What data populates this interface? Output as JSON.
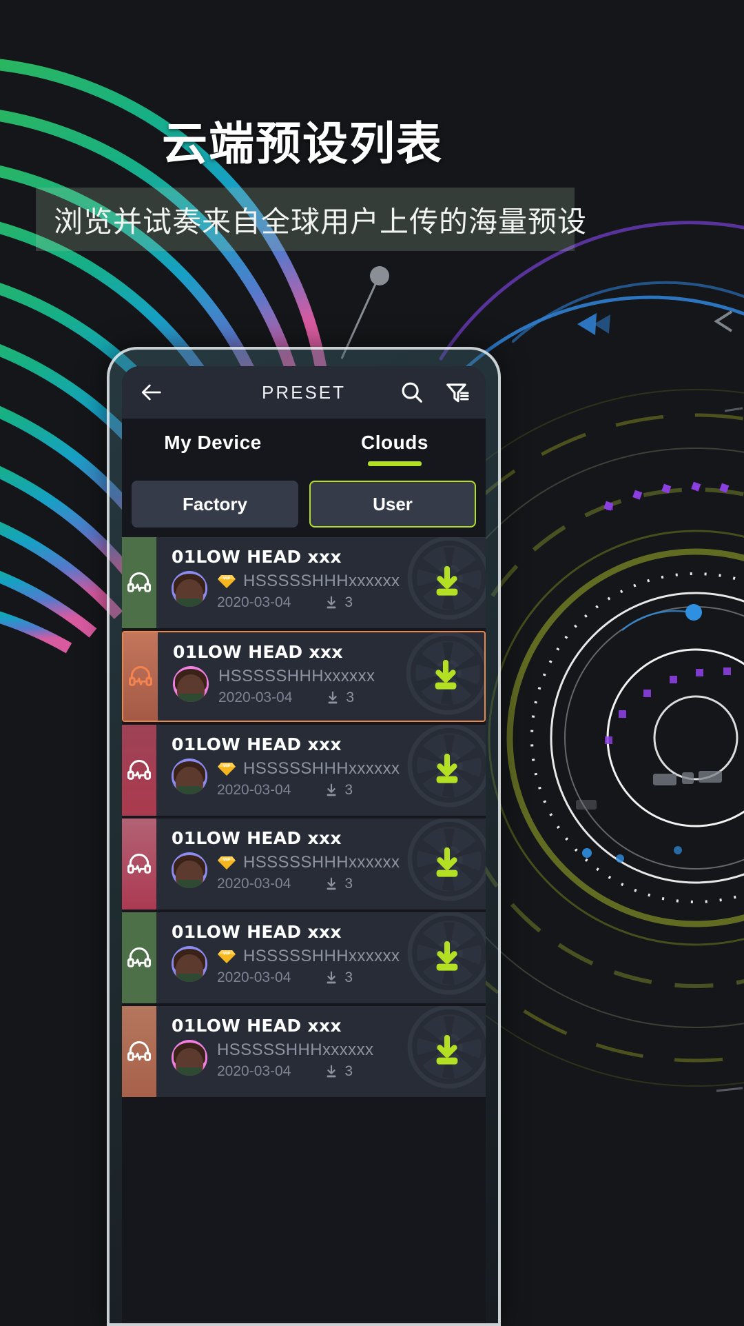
{
  "promo": {
    "title": "云端预设列表",
    "subtitle": "浏览并试奏来自全球用户上传的海量预设"
  },
  "colors": {
    "accent_green": "#b4e024",
    "selected_orange": "#e8884f",
    "screen_bg": "#15171c",
    "appbar_bg": "#262b36",
    "row_bg": "#272c37",
    "muted_text": "#8d93a0"
  },
  "appbar": {
    "back_icon": "arrow-left-icon",
    "title": "PRESET",
    "search_icon": "search-icon",
    "filter_icon": "filter-icon"
  },
  "tabs": [
    {
      "label": "My Device",
      "active": false
    },
    {
      "label": "Clouds",
      "active": true
    }
  ],
  "segments": [
    {
      "label": "Factory",
      "active": false
    },
    {
      "label": "User",
      "active": true
    }
  ],
  "list": {
    "download_icon": "download-icon",
    "headphone_icon": "headphone-waveform-icon",
    "vip_icon": "vip-diamond-icon",
    "items": [
      {
        "title": "01LOW HEAD xxx",
        "user": "HSSSSSHHHxxxxxx",
        "date": "2020-03-04",
        "downloads": "3",
        "vip": true,
        "selected": false,
        "strip_color": "#4d7049",
        "strip_color2": "#4d7049",
        "icon_color": "#ffffff",
        "avatar_bg": "#8b8bf0"
      },
      {
        "title": "01LOW HEAD xxx",
        "user": "HSSSSSHHHxxxxxx",
        "date": "2020-03-04",
        "downloads": "3",
        "vip": false,
        "selected": true,
        "strip_color": "#c4765c",
        "strip_color2": "#a45a46",
        "icon_color": "#f4844f",
        "avatar_bg": "#f07fe0"
      },
      {
        "title": "01LOW HEAD xxx",
        "user": "HSSSSSHHHxxxxxx",
        "date": "2020-03-04",
        "downloads": "3",
        "vip": true,
        "selected": false,
        "strip_color": "#9e4257",
        "strip_color2": "#ab3a4e",
        "icon_color": "#ffffff",
        "avatar_bg": "#8b8bf0"
      },
      {
        "title": "01LOW HEAD xxx",
        "user": "HSSSSSHHHxxxxxx",
        "date": "2020-03-04",
        "downloads": "3",
        "vip": true,
        "selected": false,
        "strip_color": "#b36275",
        "strip_color2": "#ab3a52",
        "icon_color": "#ffffff",
        "avatar_bg": "#8b8bf0"
      },
      {
        "title": "01LOW HEAD xxx",
        "user": "HSSSSSHHHxxxxxx",
        "date": "2020-03-04",
        "downloads": "3",
        "vip": true,
        "selected": false,
        "strip_color": "#4d7049",
        "strip_color2": "#4d7049",
        "icon_color": "#ffffff",
        "avatar_bg": "#8b8bf0"
      },
      {
        "title": "01LOW HEAD xxx",
        "user": "HSSSSSHHHxxxxxx",
        "date": "2020-03-04",
        "downloads": "3",
        "vip": false,
        "selected": false,
        "strip_color": "#b5765e",
        "strip_color2": "#a8614a",
        "icon_color": "#ffffff",
        "avatar_bg": "#f07fe0"
      }
    ]
  }
}
